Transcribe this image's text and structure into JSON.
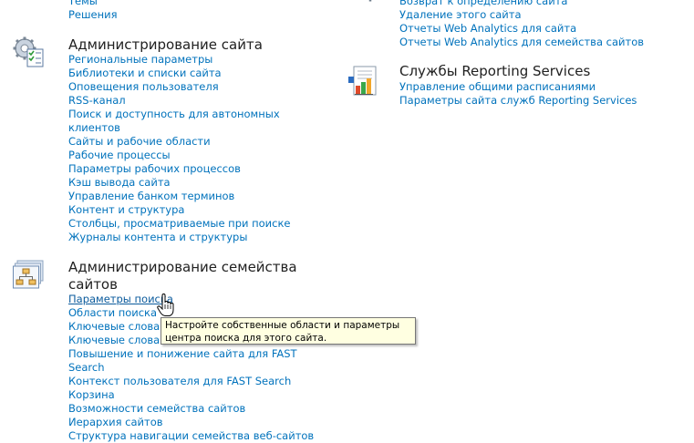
{
  "left_top": {
    "links": [
      "Темы",
      "Решения"
    ]
  },
  "site_admin": {
    "title": "Администрирование сайта",
    "icon": "gear-checklist-icon",
    "links": [
      "Региональные параметры",
      "Библиотеки и списки сайта",
      "Оповещения пользователя",
      "RSS-канал",
      "Поиск и доступность для автономных",
      "клиентов",
      "Сайты и рабочие области",
      "Рабочие процессы",
      "Параметры рабочих процессов",
      "Кэш вывода сайта",
      "Управление банком терминов",
      "Контент и структура",
      "Столбцы, просматриваемые при поиске",
      "Журналы контента и структуры"
    ]
  },
  "collection_admin": {
    "title_line1": "Администрирование семейства",
    "title_line2": "сайтов",
    "icon": "site-hierarchy-icon",
    "links": [
      "Параметры поиска",
      "Области поиска",
      "Ключевые слова",
      "Ключевые слова",
      "Повышение и понижение сайта для FAST",
      "Search",
      "Контекст пользователя для FAST Search",
      "Корзина",
      "Возможности семейства сайтов",
      "Иерархия сайтов",
      "Структура навигации семейства веб-сайтов"
    ]
  },
  "right_top": {
    "icon": "gear-icon",
    "links": [
      "Возврат к определению сайта",
      "Удаление этого сайта",
      "Отчеты Web Analytics для сайта",
      "Отчеты Web Analytics для семейства сайтов"
    ]
  },
  "reporting": {
    "title": "Службы Reporting Services",
    "icon": "report-chart-icon",
    "links": [
      "Управление общими расписаниями",
      "Параметры сайта служб Reporting Services"
    ]
  },
  "tooltip": {
    "text": "Настройте собственные области и параметры центра поиска для этого сайта."
  },
  "colors": {
    "link": "#0072bc",
    "heading": "#212121",
    "tooltip_bg": "#ffffe1"
  }
}
